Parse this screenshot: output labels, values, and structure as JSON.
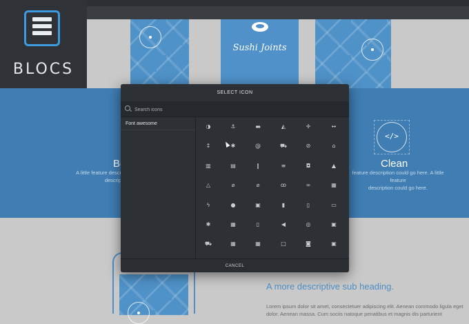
{
  "logo": {
    "text": "BLOCS"
  },
  "background": {
    "phone_title": "Sushi Joints",
    "features": [
      {
        "title": "Be",
        "desc_lines": [
          "A little feature descr",
          "descrip"
        ]
      },
      {
        "title": "Clean",
        "desc_lines": [
          "feature description could go here. A little feature",
          "description could go here."
        ]
      }
    ],
    "partial_heading": "",
    "sub_heading": "A more descriptive sub heading.",
    "lorem_lines": [
      "Lorem ipsum dolor sit amet, consectetuer adipiscing elit. Aenean commodo ligula eget",
      "dolor. Aenean massa. Cum sociis natoque penatibus et magnis dis parturient"
    ]
  },
  "modal": {
    "title": "SELECT ICON",
    "search_placeholder": "Search icons",
    "categories": [
      {
        "label": "Font awesome"
      }
    ],
    "cancel_label": "CANCEL",
    "icons": [
      {
        "name": "adjust-icon",
        "glyph": "◑"
      },
      {
        "name": "anchor-icon",
        "glyph": "⚓"
      },
      {
        "name": "archive-icon",
        "glyph": "▬"
      },
      {
        "name": "area-chart-icon",
        "glyph": "◭"
      },
      {
        "name": "arrows-icon",
        "glyph": "✛"
      },
      {
        "name": "arrows-h-icon",
        "glyph": "↔"
      },
      {
        "name": "arrows-v-icon",
        "glyph": "↕"
      },
      {
        "name": "asterisk-icon",
        "glyph": "✱"
      },
      {
        "name": "at-icon",
        "glyph": "@"
      },
      {
        "name": "automobile-icon",
        "glyph": "⛟"
      },
      {
        "name": "ban-icon",
        "glyph": "⊘"
      },
      {
        "name": "bank-icon",
        "glyph": "⌂"
      },
      {
        "name": "bar-chart-icon",
        "glyph": "▥"
      },
      {
        "name": "bar-chart-o-icon",
        "glyph": "▤"
      },
      {
        "name": "barcode-icon",
        "glyph": "‖"
      },
      {
        "name": "bars-icon",
        "glyph": "≡"
      },
      {
        "name": "beer-icon",
        "glyph": "◘"
      },
      {
        "name": "bell-icon",
        "glyph": "▲"
      },
      {
        "name": "bell-o-icon",
        "glyph": "△"
      },
      {
        "name": "bell-slash-icon",
        "glyph": "⌀"
      },
      {
        "name": "bell-slash-o-icon",
        "glyph": "⌀"
      },
      {
        "name": "bicycle-icon",
        "glyph": "ꝏ"
      },
      {
        "name": "binoculars-icon",
        "glyph": "∞"
      },
      {
        "name": "birthday-cake-icon",
        "glyph": "▦"
      },
      {
        "name": "bolt-icon",
        "glyph": "ϟ"
      },
      {
        "name": "bomb-icon",
        "glyph": "●"
      },
      {
        "name": "book-icon",
        "glyph": "▣"
      },
      {
        "name": "bookmark-icon",
        "glyph": "▮"
      },
      {
        "name": "bookmark-o-icon",
        "glyph": "▯"
      },
      {
        "name": "briefcase-icon",
        "glyph": "▭"
      },
      {
        "name": "bug-icon",
        "glyph": "✱"
      },
      {
        "name": "building-icon",
        "glyph": "▦"
      },
      {
        "name": "building-o-icon",
        "glyph": "▯"
      },
      {
        "name": "bullhorn-icon",
        "glyph": "◀"
      },
      {
        "name": "bullseye-icon",
        "glyph": "◎"
      },
      {
        "name": "bus-icon",
        "glyph": "▣"
      },
      {
        "name": "cab-icon",
        "glyph": "⛟"
      },
      {
        "name": "calculator-icon",
        "glyph": "▦"
      },
      {
        "name": "calendar-icon",
        "glyph": "▦"
      },
      {
        "name": "calendar-o-icon",
        "glyph": "□"
      },
      {
        "name": "camera-icon",
        "glyph": "◙"
      },
      {
        "name": "camera-retro-icon",
        "glyph": "▣"
      }
    ]
  },
  "colors": {
    "accent": "#3f9be0",
    "band": "#3f7db3",
    "modal_bg": "#2d3035"
  }
}
